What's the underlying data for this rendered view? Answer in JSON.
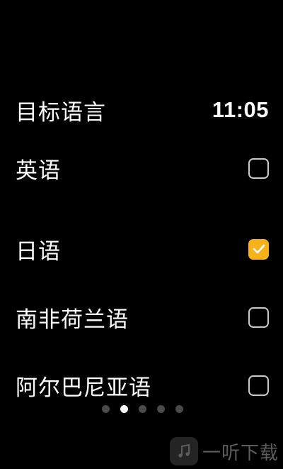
{
  "header": {
    "title": "目标语言",
    "time": "11:05"
  },
  "languages": [
    {
      "label": "英语",
      "checked": false
    },
    {
      "label": "日语",
      "checked": true
    },
    {
      "label": "南非荷兰语",
      "checked": false
    },
    {
      "label": "阿尔巴尼亚语",
      "checked": false
    }
  ],
  "pager": {
    "count": 5,
    "active_index": 1
  },
  "watermark": {
    "text": "一听下载"
  },
  "colors": {
    "accent": "#f7b21b",
    "background": "#000000",
    "text": "#ffffff",
    "checkbox_border": "#c9c9c9",
    "dot_inactive": "#4a4a4a"
  }
}
